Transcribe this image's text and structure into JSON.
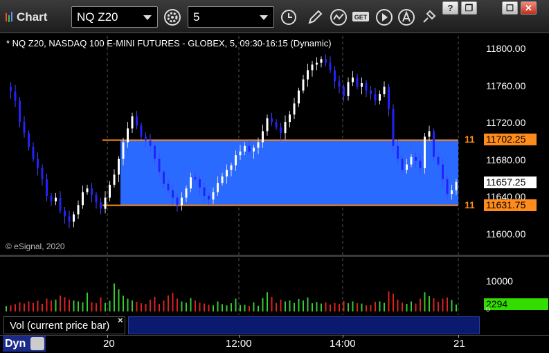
{
  "window": {
    "title": "Chart",
    "buttons": {
      "help": "?",
      "restore": "❐",
      "maximize": "☐",
      "close": "✕"
    }
  },
  "toolbar": {
    "symbol_value": "NQ Z20",
    "interval_value": "5",
    "icons": [
      "chart-settings-icon",
      "time-template-icon",
      "draw-pencil-icon",
      "studies-icon",
      "get-data-icon",
      "replay-play-icon",
      "alerts-icon",
      "link-pin-icon"
    ]
  },
  "chart": {
    "title": "* NQ Z20, NASDAQ 100 E-MINI FUTURES - GLOBEX, 5, 09:30-16:15 (Dynamic)",
    "copyright": "© eSignal, 2020",
    "price_axis": [
      "11800.00",
      "11760.00",
      "11720.00",
      "11680.00",
      "11640.00",
      "11600.00"
    ],
    "upper_line": {
      "label": "11",
      "tag": "11702.25"
    },
    "last_price_tag": "11657.25",
    "lower_line": {
      "label": "11",
      "tag": "11631.75"
    },
    "volume_axis": [
      "10000",
      "0"
    ],
    "volume_tag": "2294",
    "study_label": "Vol (current price bar)",
    "study_close": "×",
    "time_labels": [
      "20",
      "12:00",
      "14:00",
      "21"
    ],
    "dyn_label": "Dyn",
    "colors": {
      "up": "#ffffff",
      "down": "#2222ff",
      "band": "#2a6aff",
      "line": "#ff8c1a",
      "vol_up": "#33cc33",
      "vol_down": "#dd2222"
    }
  },
  "chart_data": {
    "type": "candlestick",
    "symbol": "NQ Z20",
    "ylim": [
      11580,
      11820
    ],
    "upper_level": 11702.25,
    "lower_level": 11631.75,
    "last_price": 11657.25,
    "closes": [
      11760,
      11755,
      11745,
      11722,
      11710,
      11695,
      11682,
      11672,
      11660,
      11642,
      11636,
      11640,
      11626,
      11620,
      11614,
      11622,
      11632,
      11646,
      11650,
      11643,
      11635,
      11628,
      11640,
      11654,
      11665,
      11682,
      11700,
      11715,
      11728,
      11718,
      11706,
      11702,
      11696,
      11682,
      11668,
      11655,
      11648,
      11640,
      11632,
      11640,
      11650,
      11662,
      11660,
      11651,
      11642,
      11638,
      11646,
      11656,
      11663,
      11670,
      11675,
      11686,
      11690,
      11696,
      11690,
      11694,
      11700,
      11712,
      11726,
      11722,
      11716,
      11710,
      11722,
      11730,
      11742,
      11756,
      11768,
      11778,
      11784,
      11786,
      11790,
      11786,
      11778,
      11766,
      11760,
      11750,
      11765,
      11770,
      11760,
      11764,
      11756,
      11752,
      11745,
      11752,
      11760,
      11736,
      11696,
      11682,
      11670,
      11676,
      11684,
      11680,
      11672,
      11706,
      11712,
      11684,
      11676,
      11660,
      11644,
      11648,
      11657
    ],
    "volume": [
      1800,
      2000,
      2400,
      3100,
      2600,
      3300,
      2800,
      3500,
      2500,
      4200,
      3600,
      3900,
      5200,
      4700,
      3900,
      3600,
      3300,
      3000,
      6200,
      3100,
      2700,
      4600,
      2800,
      3500,
      9200,
      7300,
      5200,
      4200,
      3600,
      3200,
      2700,
      2500,
      3900,
      4800,
      2500,
      3600,
      5300,
      6100,
      4200,
      3300,
      2900,
      4400,
      3600,
      2900,
      2600,
      2200,
      2000,
      3300,
      2400,
      2000,
      2700,
      4200,
      2100,
      2200,
      1800,
      3000,
      1900,
      4400,
      6300,
      4800,
      2800,
      3900,
      3300,
      3600,
      2800,
      4100,
      3600,
      4600,
      2700,
      3100,
      2600,
      3000,
      2300,
      2800,
      2500,
      3400,
      2700,
      3300,
      2700,
      2600,
      2000,
      2100,
      3200,
      3300,
      2800,
      6600,
      5800,
      3900,
      2900,
      2500,
      3300,
      2600,
      4200,
      6300,
      5000,
      4300,
      3200,
      4200,
      4600,
      3800,
      2294
    ]
  }
}
